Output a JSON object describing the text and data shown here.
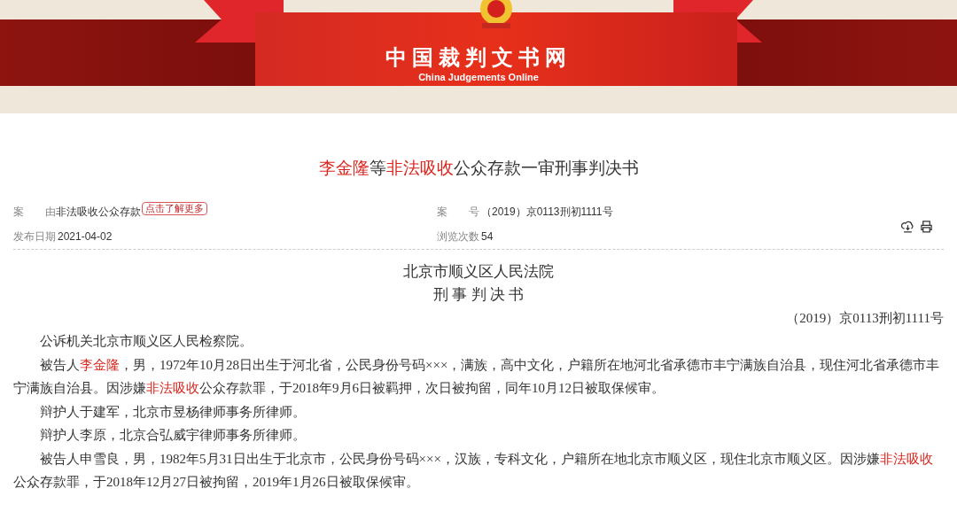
{
  "header": {
    "site_name": "中国裁判文书网",
    "site_name_en": "China Judgements Online"
  },
  "title": [
    {
      "text": "李金隆",
      "highlighted": true
    },
    {
      "text": "等",
      "highlighted": false
    },
    {
      "text": "非法吸收",
      "highlighted": true
    },
    {
      "text": "公众存款一审刑事判决书",
      "highlighted": false
    }
  ],
  "meta": {
    "cause_label": "案　　由",
    "cause_value": "非法吸收公众存款",
    "more_tag": "点击了解更多",
    "case_no_label": "案　　号",
    "case_no_value": "（2019）京0113刑初1111号",
    "date_label": "发布日期",
    "date_value": "2021-04-02",
    "views_label": "浏览次数",
    "views_value": "54"
  },
  "document": {
    "court": "北京市顺义区人民法院",
    "doc_type": "刑 事 判 决 书",
    "case_no": "（2019）京0113刑初1111号",
    "paragraphs": [
      [
        {
          "text": "公诉机关北京市顺义区人民检察院。",
          "highlighted": false
        }
      ],
      [
        {
          "text": "被告人",
          "highlighted": false
        },
        {
          "text": "李金隆",
          "highlighted": true
        },
        {
          "text": "，男，1972年10月28日出生于河北省，公民身份号码×××，满族，高中文化，户籍所在地河北省承德市丰宁满族自治县，现住河北省承德市丰宁满族自治县。因涉嫌",
          "highlighted": false
        },
        {
          "text": "非法吸收",
          "highlighted": true
        },
        {
          "text": "公众存款罪，于2018年9月6日被羁押，次日被拘留，同年10月12日被取保候审。",
          "highlighted": false
        }
      ],
      [
        {
          "text": "辩护人于建军，北京市昱杨律师事务所律师。",
          "highlighted": false
        }
      ],
      [
        {
          "text": "辩护人李原，北京合弘威宇律师事务所律师。",
          "highlighted": false
        }
      ],
      [
        {
          "text": "被告人申雪良，男，1982年5月31日出生于北京市，公民身份号码×××，汉族，专科文化，户籍所在地北京市顺义区，现住北京市顺义区。因涉嫌",
          "highlighted": false
        },
        {
          "text": "非法吸收",
          "highlighted": true
        },
        {
          "text": "公众存款罪，于2018年12月27日被拘留，2019年1月26日被取保候审。",
          "highlighted": false
        }
      ]
    ]
  }
}
